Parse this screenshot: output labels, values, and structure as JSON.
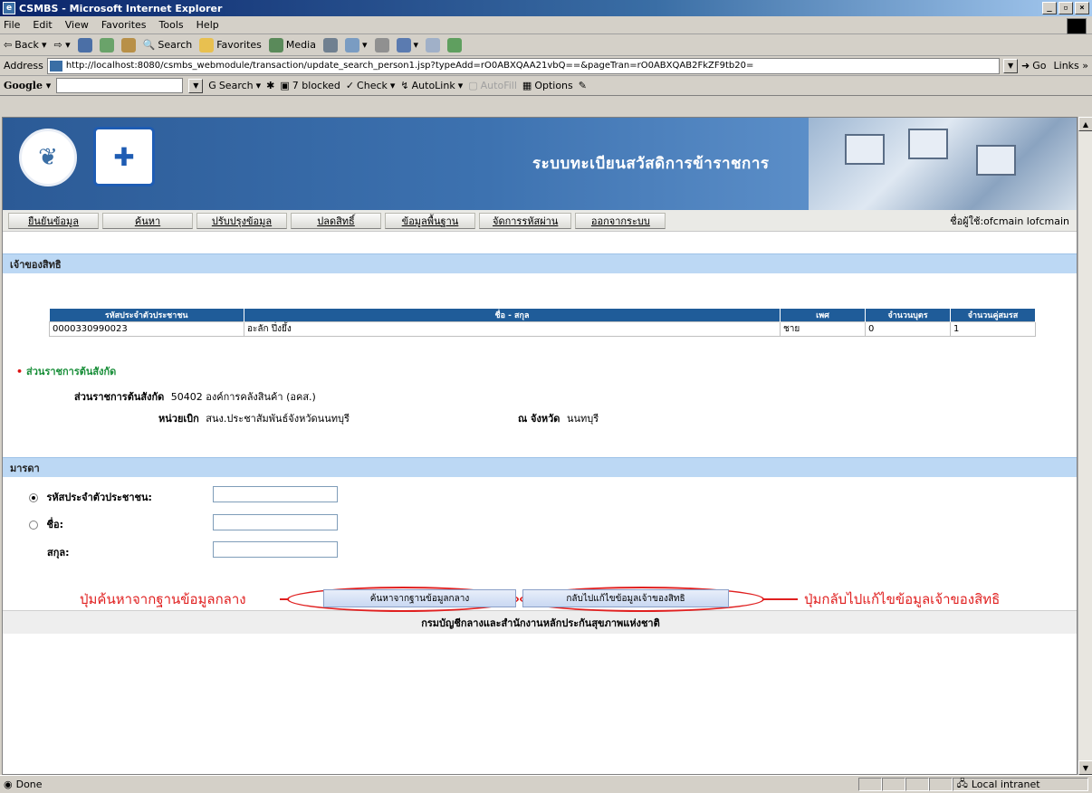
{
  "window": {
    "title": "CSMBS - Microsoft Internet Explorer",
    "minimize": "_",
    "maximize": "▫",
    "close": "×"
  },
  "menu": [
    "File",
    "Edit",
    "View",
    "Favorites",
    "Tools",
    "Help"
  ],
  "toolbar": {
    "back": "Back",
    "search": "Search",
    "favorites": "Favorites",
    "media": "Media"
  },
  "address": {
    "label": "Address",
    "url": "http://localhost:8080/csmbs_webmodule/transaction/update_search_person1.jsp?typeAdd=rO0ABXQAA21vbQ==&pageTran=rO0ABXQAB2FkZF9tb20=",
    "go": "Go",
    "links": "Links »"
  },
  "google": {
    "logo": "Google",
    "search": "Search",
    "blocked": "7 blocked",
    "check": "Check",
    "autolink": "AutoLink",
    "autofill": "AutoFill",
    "options": "Options"
  },
  "banner": {
    "title": "ระบบทะเบียนสวัสดิการข้าราชการ"
  },
  "nav": {
    "items": [
      "ยืนยันข้อมูล",
      "ค้นหา",
      "ปรับปรุงข้อมูล",
      "ปลดสิทธิ์",
      "ข้อมูลพื้นฐาน",
      "จัดการรหัสผ่าน",
      "ออกจากระบบ"
    ],
    "user": "ชื่อผู้ใช้:ofcmain lofcmain"
  },
  "owner": {
    "section": "เจ้าของสิทธิ",
    "columns": [
      "รหัสประจำตัวประชาชน",
      "ชื่อ - สกุล",
      "เพศ",
      "จำนวนบุตร",
      "จำนวนคู่สมรส"
    ],
    "rows": [
      [
        "0000330990023",
        "อะลัก ปึ่งยึ้ง",
        "ชาย",
        "0",
        "1"
      ]
    ]
  },
  "agency": {
    "heading": "ส่วนราชการต้นสังกัด",
    "agency_label": "ส่วนราชการต้นสังกัด",
    "agency_value": "50402 องค์การคลังสินค้า (อคส.)",
    "unit_label": "หน่วยเบิก",
    "unit_value": "สนง.ประชาสัมพันธ์จังหวัดนนทบุรี",
    "province_label": "ณ จังหวัด",
    "province_value": "นนทบุรี"
  },
  "mother": {
    "section": "มารดา",
    "id_label": "รหัสประจำตัวประชาชน:",
    "name_label": "ชื่อ:",
    "surname_label": "สกุล:",
    "selected": "id"
  },
  "actions": {
    "search_central": "ค้นหาจากฐานข้อมูลกลาง",
    "back_edit": "กลับไปแก้ไขข้อมูลเจ้าของสิทธิ"
  },
  "callouts": {
    "left": "ปุ่มค้นหาจากฐานข้อมูลกลาง",
    "right": "ปุ่มกลับไปแก้ไขข้อมูลเจ้าของสิทธิ"
  },
  "footer": "กรมบัญชีกลางและสำนักงานหลักประกันสุขภาพแห่งชาติ",
  "status": {
    "text": "Done",
    "zone": "Local intranet"
  },
  "colors": {
    "accent": "#1f5c99",
    "section": "#bcd8f4",
    "callout": "#e02020",
    "agency_heading": "#1a8f3a"
  }
}
